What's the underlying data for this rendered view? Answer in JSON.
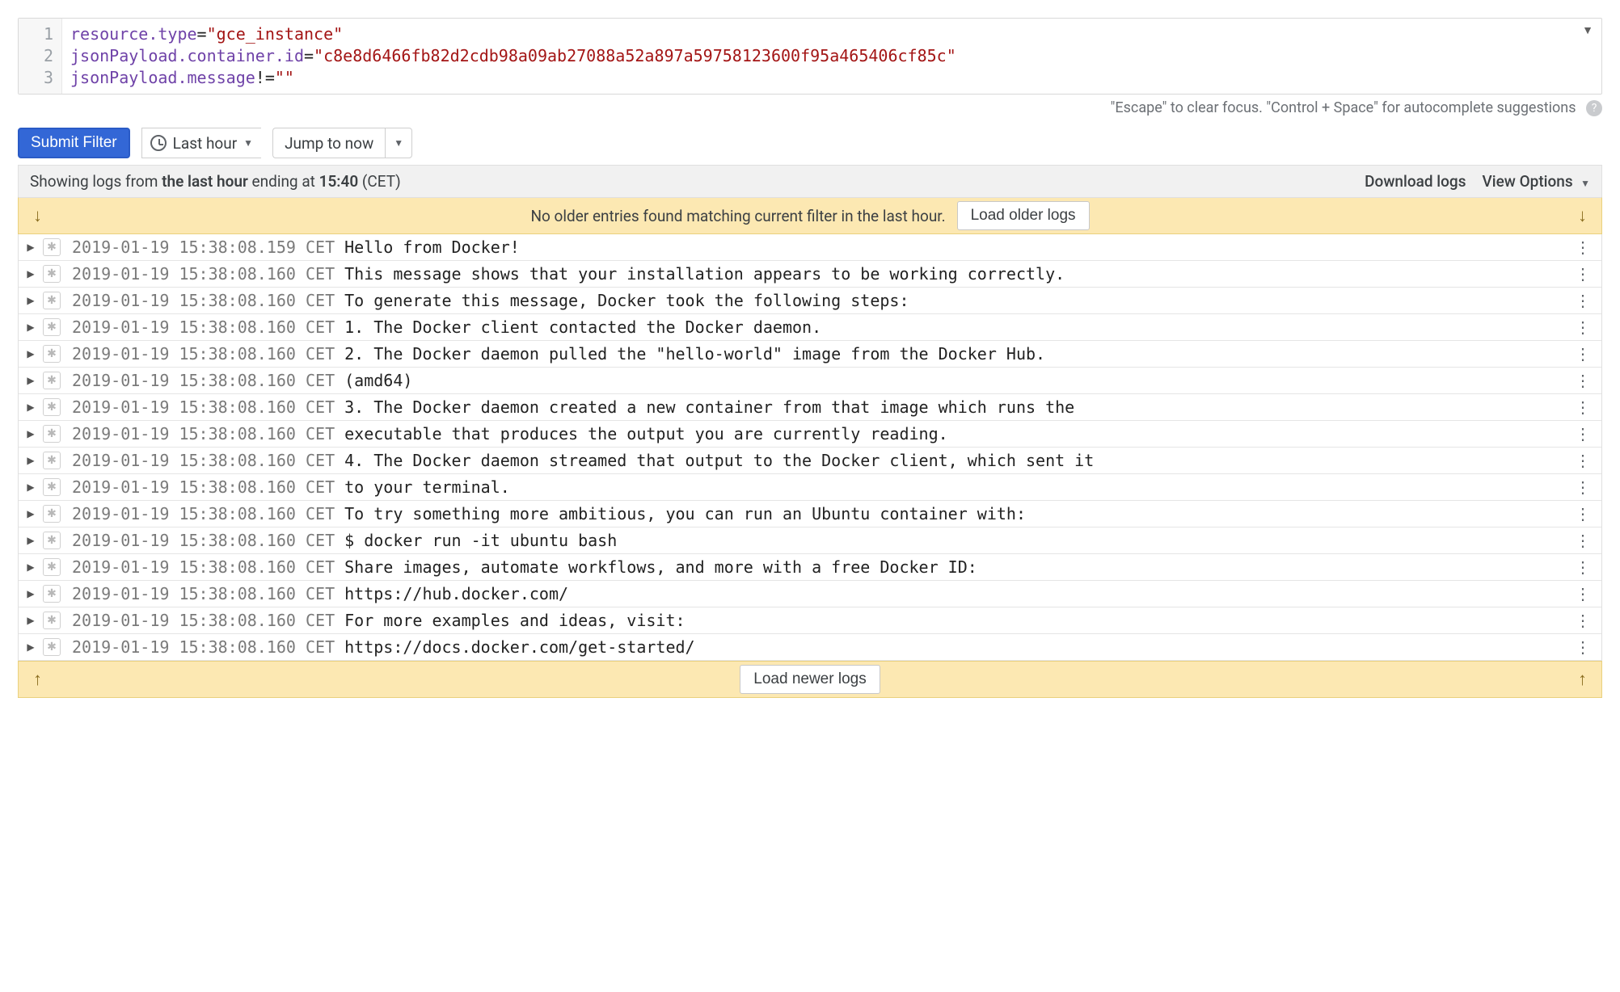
{
  "filter": {
    "line_numbers": [
      "1",
      "2",
      "3"
    ],
    "lines": [
      {
        "key": "resource.type",
        "op": "=",
        "value": "\"gce_instance\""
      },
      {
        "key": "jsonPayload.container.id",
        "op": "=",
        "value": "\"c8e8d6466fb82d2cdb98a09ab27088a52a897a59758123600f95a465406cf85c\""
      },
      {
        "key": "jsonPayload.message",
        "op": "!=",
        "value": "\"\""
      }
    ]
  },
  "hint_text": "\"Escape\" to clear focus. \"Control + Space\" for autocomplete suggestions",
  "toolbar": {
    "submit_label": "Submit Filter",
    "time_range_label": "Last hour",
    "jump_label": "Jump to now"
  },
  "status": {
    "prefix": "Showing logs from ",
    "range": "the last hour",
    "mid": " ending at ",
    "time": "15:40",
    "tz": " (CET)",
    "download_label": "Download logs",
    "view_options_label": "View Options"
  },
  "older_banner": {
    "message": "No older entries found matching current filter in the last hour.",
    "button": "Load older logs"
  },
  "newer_banner": {
    "button": "Load newer logs"
  },
  "logs": [
    {
      "ts": "2019-01-19 15:38:08.159 CET",
      "msg": "Hello from Docker!"
    },
    {
      "ts": "2019-01-19 15:38:08.160 CET",
      "msg": "This message shows that your installation appears to be working correctly."
    },
    {
      "ts": "2019-01-19 15:38:08.160 CET",
      "msg": "To generate this message, Docker took the following steps:"
    },
    {
      "ts": "2019-01-19 15:38:08.160 CET",
      "msg": "1. The Docker client contacted the Docker daemon."
    },
    {
      "ts": "2019-01-19 15:38:08.160 CET",
      "msg": "2. The Docker daemon pulled the \"hello-world\" image from the Docker Hub."
    },
    {
      "ts": "2019-01-19 15:38:08.160 CET",
      "msg": "(amd64)"
    },
    {
      "ts": "2019-01-19 15:38:08.160 CET",
      "msg": "3. The Docker daemon created a new container from that image which runs the"
    },
    {
      "ts": "2019-01-19 15:38:08.160 CET",
      "msg": "executable that produces the output you are currently reading."
    },
    {
      "ts": "2019-01-19 15:38:08.160 CET",
      "msg": "4. The Docker daemon streamed that output to the Docker client, which sent it"
    },
    {
      "ts": "2019-01-19 15:38:08.160 CET",
      "msg": "to your terminal."
    },
    {
      "ts": "2019-01-19 15:38:08.160 CET",
      "msg": "To try something more ambitious, you can run an Ubuntu container with:"
    },
    {
      "ts": "2019-01-19 15:38:08.160 CET",
      "msg": "$ docker run -it ubuntu bash"
    },
    {
      "ts": "2019-01-19 15:38:08.160 CET",
      "msg": "Share images, automate workflows, and more with a free Docker ID:"
    },
    {
      "ts": "2019-01-19 15:38:08.160 CET",
      "msg": "https://hub.docker.com/"
    },
    {
      "ts": "2019-01-19 15:38:08.160 CET",
      "msg": "For more examples and ideas, visit:"
    },
    {
      "ts": "2019-01-19 15:38:08.160 CET",
      "msg": "https://docs.docker.com/get-started/"
    }
  ]
}
